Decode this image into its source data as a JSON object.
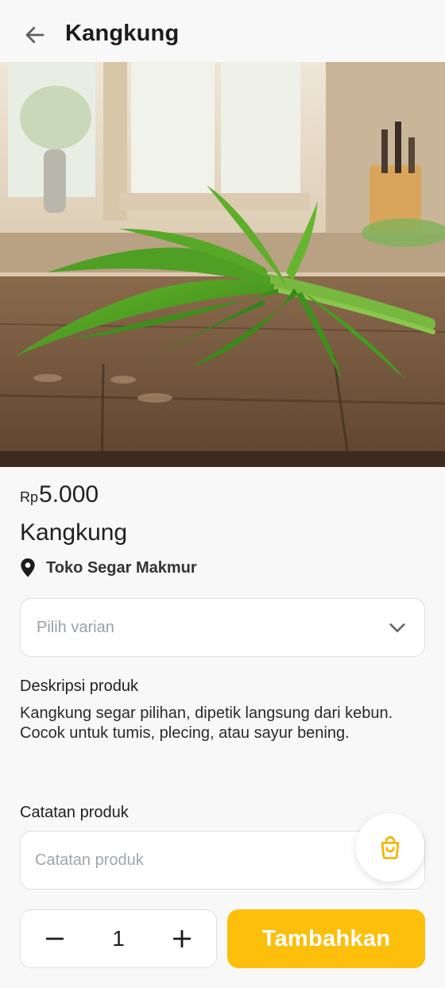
{
  "header": {
    "title": "Kangkung",
    "back_icon": "arrow-left-icon"
  },
  "hero": {
    "image_subject": "bunch of fresh water spinach on wooden table"
  },
  "product": {
    "currency": "Rp",
    "price": "5.000",
    "name": "Kangkung",
    "store_icon": "location-pin-icon",
    "store_name": "Toko Segar Makmur"
  },
  "variant": {
    "placeholder": "Pilih varian",
    "icon": "chevron-down-icon"
  },
  "description": {
    "title": "Deskripsi produk",
    "text": "Kangkung segar pilihan, dipetik langsung dari kebun. Cocok untuk tumis, plecing, atau sayur bening."
  },
  "notes": {
    "title": "Catatan produk",
    "placeholder": "Catatan produk",
    "value": ""
  },
  "cart": {
    "icon": "shopping-bag-icon"
  },
  "quantity": {
    "value": "1",
    "minus_icon": "minus-icon",
    "plus_icon": "plus-icon"
  },
  "actions": {
    "add_label": "Tambahkan"
  },
  "colors": {
    "accent": "#fbbf0c",
    "background": "#f8f8f8",
    "border": "#e3ded6"
  }
}
